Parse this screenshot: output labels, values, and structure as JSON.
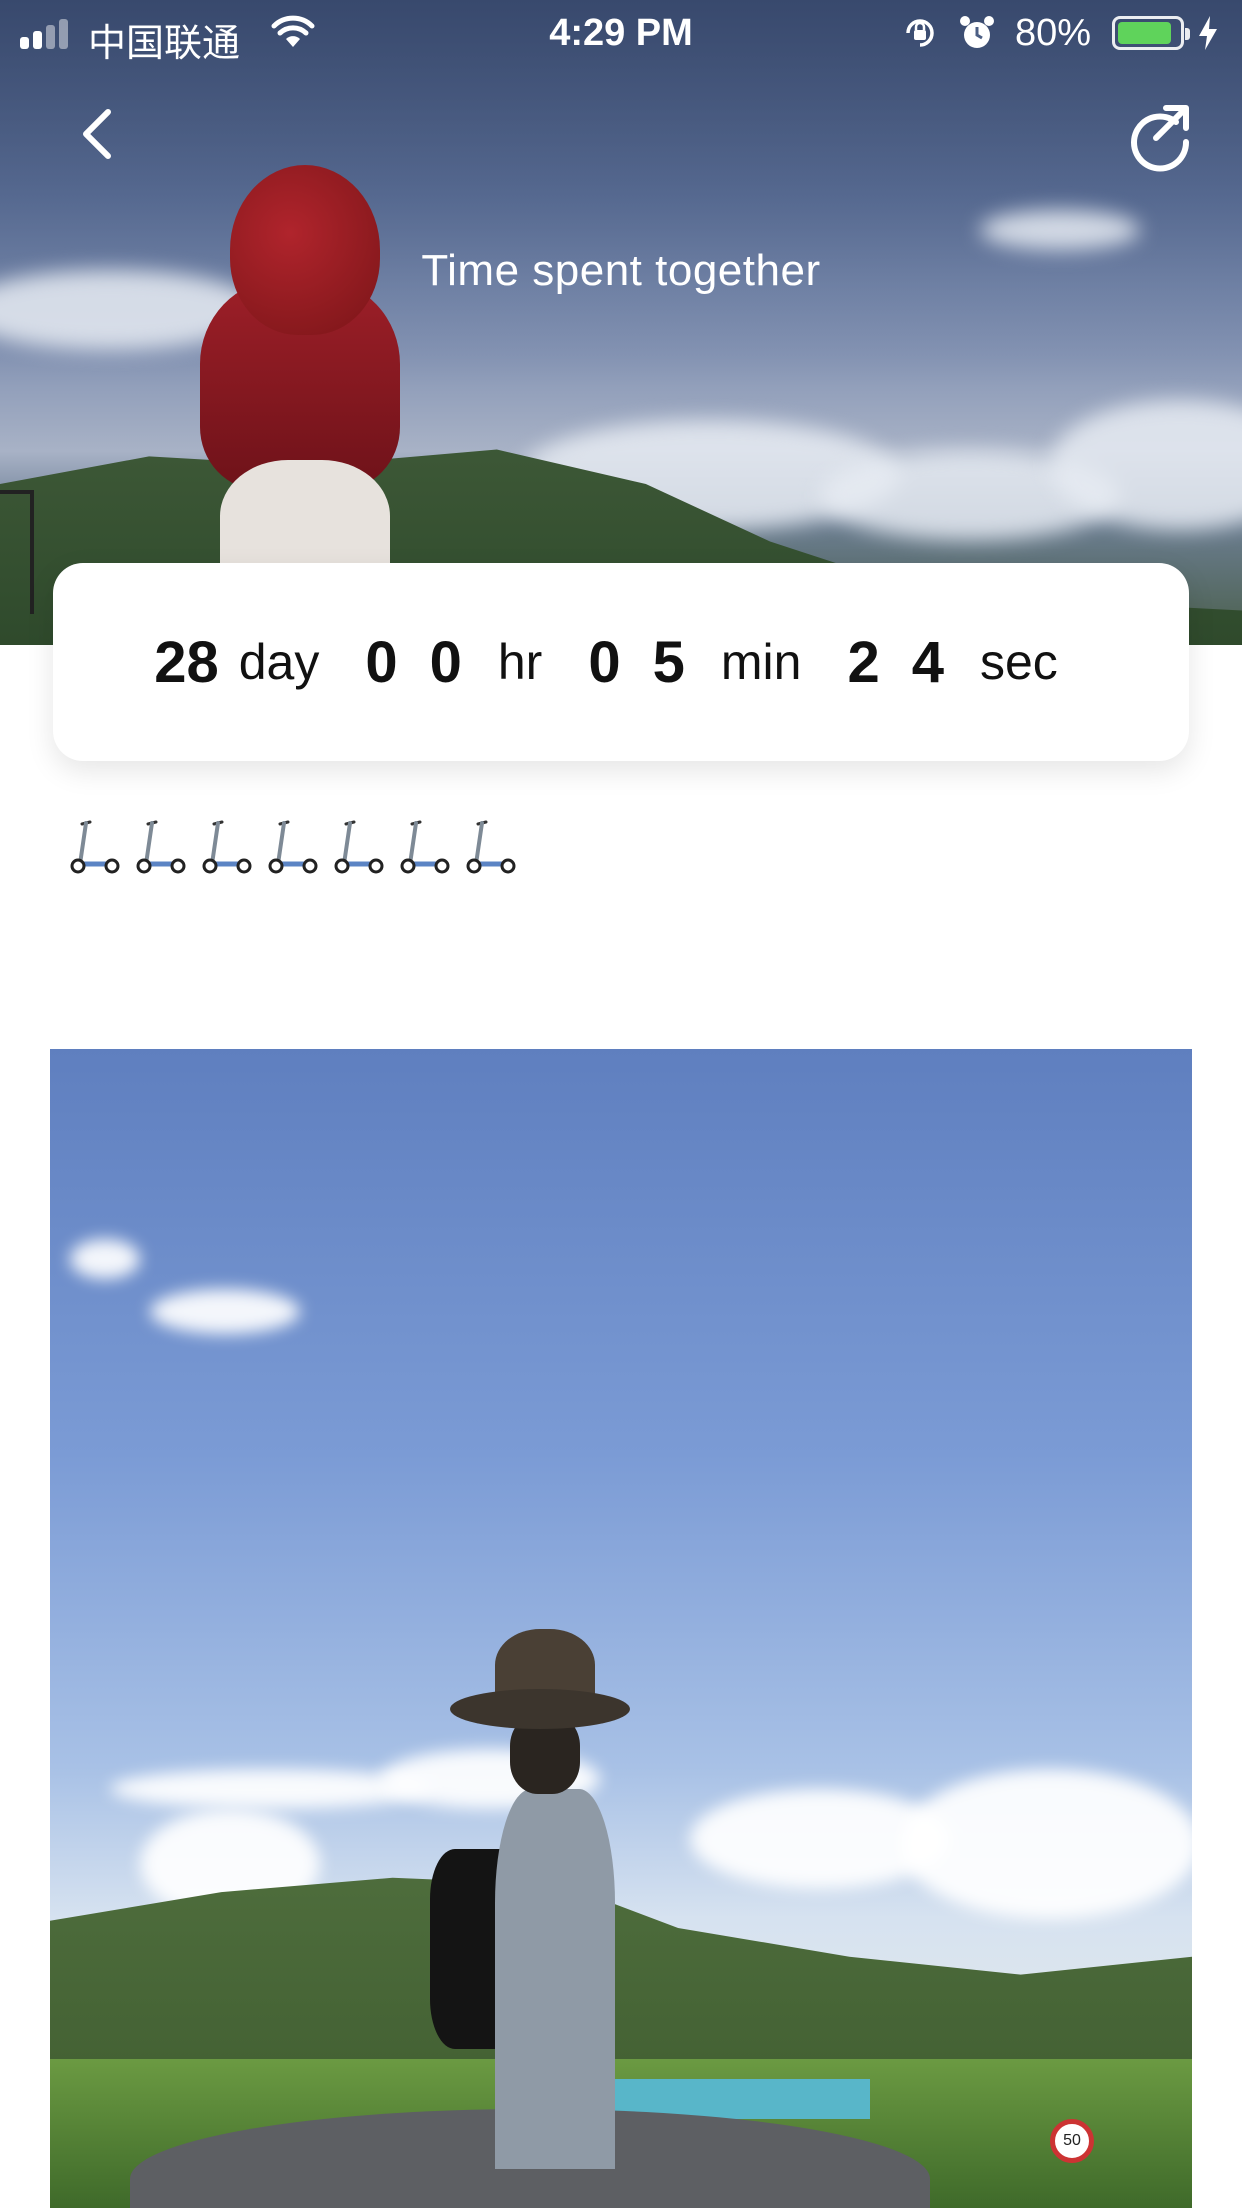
{
  "status_bar": {
    "carrier": "中国联通",
    "time": "4:29 PM",
    "battery_percent": "80%",
    "battery_level": 0.8,
    "signal_bars_filled": 2,
    "icons": [
      "signal-icon",
      "wifi-icon",
      "rotation-lock-icon",
      "alarm-icon",
      "battery-icon",
      "charging-bolt-icon"
    ]
  },
  "nav": {
    "back_icon": "chevron-left-icon",
    "share_icon": "share-icon",
    "title": "Time spent together"
  },
  "timer": {
    "days": "28",
    "days_label": "day",
    "hours": [
      "0",
      "0"
    ],
    "hours_label": "hr",
    "minutes": [
      "0",
      "5"
    ],
    "minutes_label": "min",
    "seconds": [
      "2",
      "4"
    ],
    "seconds_label": "sec"
  },
  "scooters": {
    "count": 7,
    "icon": "kick-scooter-icon"
  },
  "photos": {
    "header_photo": "person-in-red-scarf-photo",
    "main_photo": "person-with-hat-photo",
    "road_sign": "50"
  }
}
